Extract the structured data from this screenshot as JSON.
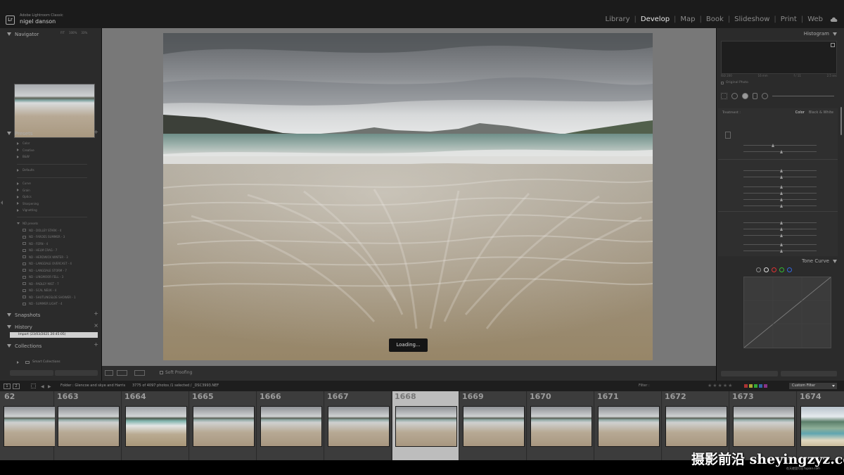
{
  "app": {
    "product_name": "Adobe Lightroom Classic",
    "user_name": "nigel danson",
    "modules": [
      {
        "label": "Library",
        "active": false
      },
      {
        "label": "Develop",
        "active": true
      },
      {
        "label": "Map",
        "active": false
      },
      {
        "label": "Book",
        "active": false
      },
      {
        "label": "Slideshow",
        "active": false
      },
      {
        "label": "Print",
        "active": false
      },
      {
        "label": "Web",
        "active": false
      }
    ]
  },
  "left_panel": {
    "navigator": {
      "title": "Navigator",
      "zoom_options": [
        "FIT",
        "100%",
        "33%"
      ]
    },
    "presets": {
      "title": "Presets",
      "groups_a": [
        "Color",
        "Creative",
        "B&W"
      ],
      "groups_b": [
        "Defaults"
      ],
      "groups_c": [
        "Curve",
        "Grain",
        "Optics",
        "Sharpening",
        "Vignetting"
      ],
      "nd_group": "ND presets",
      "nd_items": [
        "ND - DOLLEY STARK - 4",
        "ND - FAROES SUMMER - 3",
        "ND - FERN - 4",
        "ND - HELM CRAG - 7",
        "ND - HERDWICK WINTER - 3",
        "ND - LANGDALE OVERCAST - 4",
        "ND - LANGDALE STORM - 7",
        "ND - LINGMOOR FELL - 3",
        "ND - PADLEY MIST - 7",
        "ND - SCAL NEUK - 4",
        "ND - SHUTLINGSLOE SHOWER - 1",
        "ND - SUMMER LIGHT - 4"
      ]
    },
    "snapshots": {
      "title": "Snapshots"
    },
    "history": {
      "title": "History",
      "item": "Import (23/03/2021 20:45:05)"
    },
    "collections": {
      "title": "Collections",
      "smart": "Smart Collections"
    }
  },
  "center": {
    "loading_text": "Loading...",
    "soft_proofing": "Soft Proofing"
  },
  "right_panel": {
    "histogram": {
      "title": "Histogram",
      "labels": [
        "ISO 200",
        "16 mm",
        "f / 11",
        "2.5 sec"
      ],
      "original_photo": "Original Photo"
    },
    "basic": {
      "treatment": "Treatment :",
      "options": [
        "Color",
        "Black & White"
      ]
    },
    "tone_curve": {
      "title": "Tone Curve"
    }
  },
  "filmstrip": {
    "folder": "Folder : Glencoe and skye and Harris",
    "count": "3775 of 4097 photos /1 selected / _DSC3993.NEF",
    "filter_label": "Filter :",
    "filter_value": "Custom Filter",
    "frames": [
      {
        "number": "62",
        "style": "normal",
        "selected": false
      },
      {
        "number": "1663",
        "style": "normal",
        "selected": false
      },
      {
        "number": "1664",
        "style": "teal",
        "selected": false
      },
      {
        "number": "1665",
        "style": "normal",
        "selected": false
      },
      {
        "number": "1666",
        "style": "normal",
        "selected": false
      },
      {
        "number": "1667",
        "style": "normal",
        "selected": false
      },
      {
        "number": "1668",
        "style": "normal",
        "selected": true
      },
      {
        "number": "1669",
        "style": "normal",
        "selected": false
      },
      {
        "number": "1670",
        "style": "normal",
        "selected": false
      },
      {
        "number": "1671",
        "style": "normal",
        "selected": false
      },
      {
        "number": "1672",
        "style": "normal",
        "selected": false
      },
      {
        "number": "1673",
        "style": "normal",
        "selected": false
      },
      {
        "number": "1674",
        "style": "bright",
        "selected": false
      }
    ]
  },
  "watermark": {
    "text": "摄影前沿 sheyingzyz.com",
    "sub": "在天使里打出 tupian.com"
  }
}
